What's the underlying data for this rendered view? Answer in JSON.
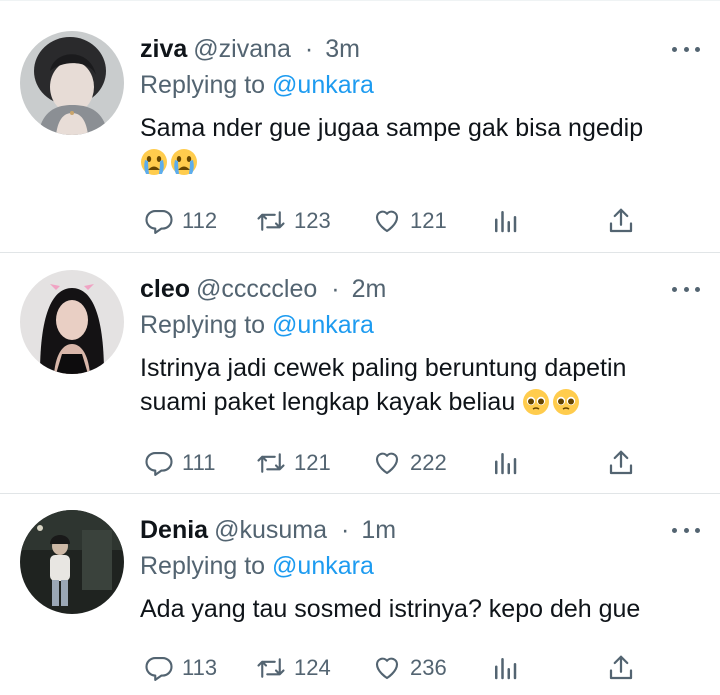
{
  "tweets": [
    {
      "name": "ziva",
      "handle": "@zivana",
      "separator": "·",
      "time": "3m",
      "replying_prefix": "Replying to",
      "replying_to": "@unkara",
      "text": "Sama nder gue jugaa sampe gak bisa ngedip",
      "emojis": [
        "crying-face-emoji",
        "crying-face-emoji"
      ],
      "replies": "112",
      "retweets": "123",
      "likes": "121"
    },
    {
      "name": "cleo",
      "handle": "@cccccleo",
      "separator": "·",
      "time": "2m",
      "replying_prefix": "Replying to",
      "replying_to": "@unkara",
      "text_line1": "Istrinya jadi cewek paling beruntung dapetin",
      "text_line2": "suami paket lengkap kayak beliau",
      "emojis": [
        "pleading-face-emoji",
        "pleading-face-emoji"
      ],
      "replies": "111",
      "retweets": "121",
      "likes": "222"
    },
    {
      "name": "Denia",
      "handle": "@kusuma",
      "separator": "·",
      "time": "1m",
      "replying_prefix": "Replying to",
      "replying_to": "@unkara",
      "text": "Ada yang tau sosmed istrinya? kepo deh gue",
      "replies": "113",
      "retweets": "124",
      "likes": "236"
    }
  ],
  "colors": {
    "link": "#1d9bf0",
    "secondary": "#536471",
    "primary": "#0f1419"
  }
}
